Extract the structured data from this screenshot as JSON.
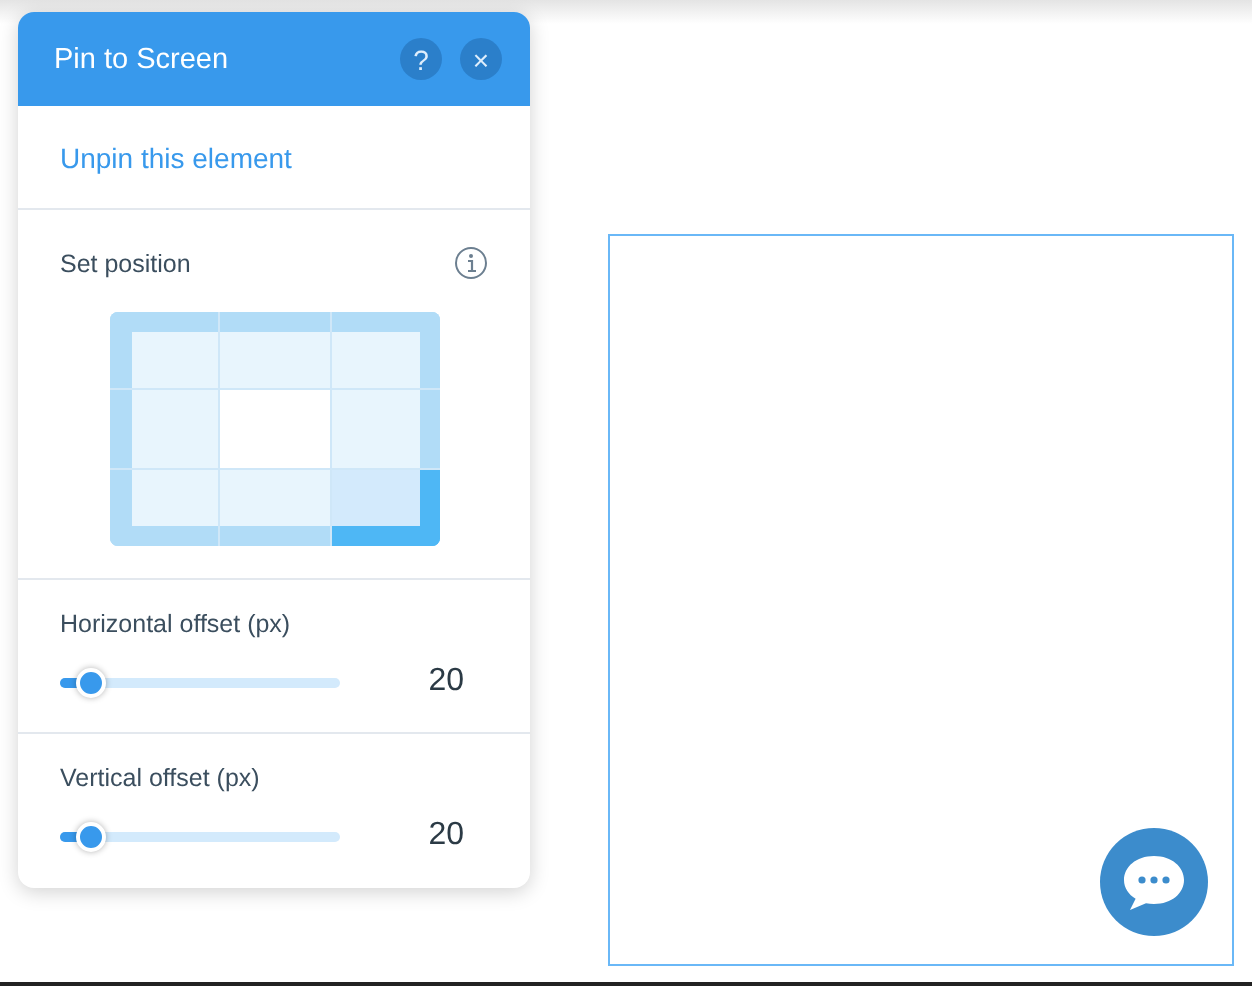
{
  "panel": {
    "title": "Pin to Screen",
    "help_button": "?",
    "close_button": "×",
    "unpin_link": "Unpin this element",
    "position": {
      "label": "Set position",
      "cells": [
        {
          "selected": false
        },
        {
          "selected": false
        },
        {
          "selected": false
        },
        {
          "selected": false
        },
        {
          "selected": false
        },
        {
          "selected": false
        },
        {
          "selected": false
        },
        {
          "selected": false
        },
        {
          "selected": true
        }
      ]
    },
    "sliders": [
      {
        "label": "Horizontal offset (px)",
        "level": 0.11,
        "value": "20"
      },
      {
        "label": "Vertical offset (px)",
        "level": 0.11,
        "value": "20"
      }
    ]
  }
}
